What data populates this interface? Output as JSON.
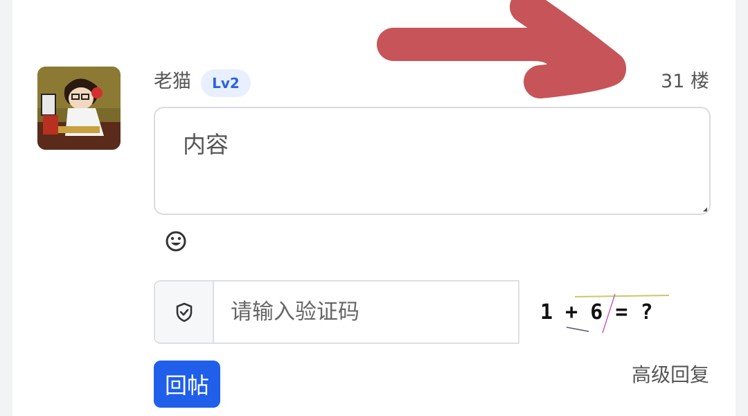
{
  "post": {
    "username": "老猫",
    "level_badge": "Lv2",
    "floor": "31 楼"
  },
  "editor": {
    "content_placeholder": "内容"
  },
  "captcha": {
    "input_placeholder": "请输入验证码",
    "challenge_text": "1 + 6 = ?"
  },
  "actions": {
    "reply_label": "回帖",
    "advanced_reply_label": "高级回复"
  },
  "icons": {
    "emoji": "smile-icon",
    "captcha_addon": "shield-check-icon",
    "annotation": "arrow-annotation"
  },
  "colors": {
    "primary": "#1f5fe9",
    "badge_bg": "#e8efff",
    "badge_text": "#2b63e0",
    "annotation": "#c65458"
  }
}
